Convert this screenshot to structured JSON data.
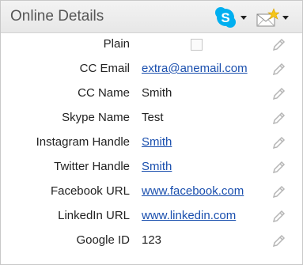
{
  "header": {
    "title": "Online Details",
    "skype_icon": "skype-icon",
    "mail_icon": "new-email-icon"
  },
  "rows": [
    {
      "label": "Plain",
      "type": "checkbox",
      "checked": false
    },
    {
      "label": "CC Email",
      "value": "extra@anemail.com",
      "link": true
    },
    {
      "label": "CC Name",
      "value": "Smith",
      "link": false
    },
    {
      "label": "Skype Name",
      "value": "Test",
      "link": false
    },
    {
      "label": "Instagram Handle",
      "value": "Smith",
      "link": true
    },
    {
      "label": "Twitter Handle",
      "value": "Smith",
      "link": true
    },
    {
      "label": "Facebook URL",
      "value": "www.facebook.com",
      "link": true
    },
    {
      "label": "LinkedIn URL",
      "value": "www.linkedin.com",
      "link": true
    },
    {
      "label": "Google ID",
      "value": "123",
      "link": false
    }
  ],
  "colors": {
    "link": "#1a4fae",
    "skype": "#00aff0",
    "edit_icon": "#b5b5b5"
  }
}
